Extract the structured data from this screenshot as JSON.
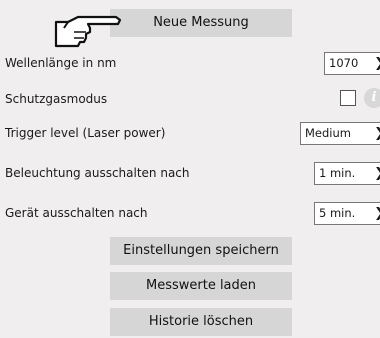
{
  "buttons": {
    "new_measurement": "Neue Messung",
    "save_settings": "Einstellungen speichern",
    "load_values": "Messwerte laden",
    "clear_history": "Historie löschen"
  },
  "settings": {
    "wavelength": {
      "label": "Wellenlänge in nm",
      "value": "1070"
    },
    "shielding_gas": {
      "label": "Schutzgasmodus",
      "checked": false
    },
    "trigger_level": {
      "label": "Trigger level (Laser power)",
      "value": "Medium"
    },
    "lighting_off": {
      "label": "Beleuchtung ausschalten nach",
      "value": "1 min."
    },
    "device_off": {
      "label": "Gerät ausschalten nach",
      "value": "5 min."
    }
  },
  "icons": {
    "pointer": "pointing-hand-icon",
    "info": "info-icon",
    "dropdown": "chevron-down-icon"
  }
}
